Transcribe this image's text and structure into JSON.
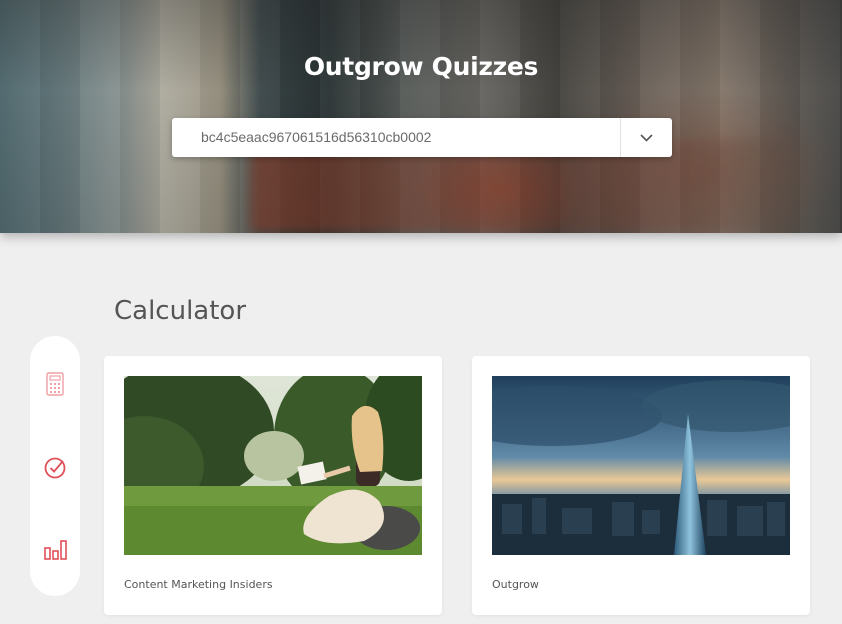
{
  "header": {
    "title": "Outgrow Quizzes"
  },
  "selector": {
    "value": "bc4c5eaac967061516d56310cb0002",
    "arrow_icon": "chevron-down-icon"
  },
  "section": {
    "title": "Calculator"
  },
  "side_nav": {
    "items": [
      {
        "icon": "calculator-icon"
      },
      {
        "icon": "check-circle-icon"
      },
      {
        "icon": "bar-chart-icon"
      }
    ],
    "accent_color": "#e0505a"
  },
  "cards": [
    {
      "label": "Content Marketing Insiders",
      "image": "woman-reading-in-park-photo"
    },
    {
      "label": "Outgrow",
      "image": "city-skyline-shard-tower-photo"
    }
  ]
}
